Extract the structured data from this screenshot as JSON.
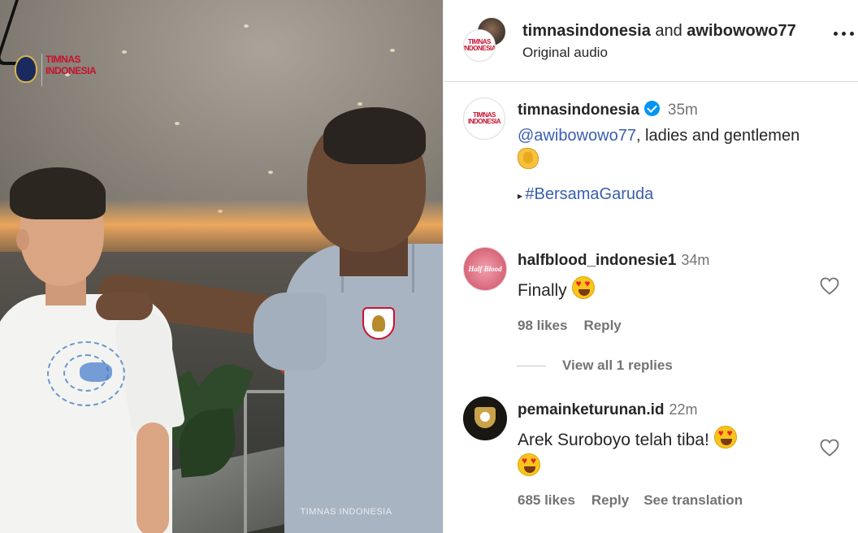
{
  "media": {
    "logo_text": "TIMNAS INDONESIA",
    "watermark": "TIMNAS INDONESIA"
  },
  "header": {
    "account_primary": "timnasindonesia",
    "joiner": " and ",
    "account_secondary": "awibowowo77",
    "audio_label": "Original audio",
    "more_icon": "more-horizontal-icon"
  },
  "caption": {
    "username": "timnasindonesia",
    "verified": true,
    "time": "35m",
    "mention": "@awibowowo77",
    "text": ", ladies and gentlemen",
    "emoji": "clapping-hands",
    "bullet": "▸ ",
    "hashtag": "#BersamaGaruda"
  },
  "comments": [
    {
      "username": "halfblood_indonesie1",
      "avatar_text": "Half Blood",
      "time": "34m",
      "text": "Finally",
      "emoji": "heart-eyes",
      "likes": "98 likes",
      "reply": "Reply",
      "view_replies": "View all 1 replies"
    },
    {
      "username": "pemainketurunan.id",
      "time": "22m",
      "text": "Arek Suroboyo telah tiba!",
      "emoji": "heart-eyes",
      "likes": "685 likes",
      "reply": "Reply",
      "translate": "See translation"
    }
  ],
  "colors": {
    "link": "#3a5fae",
    "verified": "#0095f6",
    "muted": "#737373",
    "brand_red": "#c8102e"
  }
}
